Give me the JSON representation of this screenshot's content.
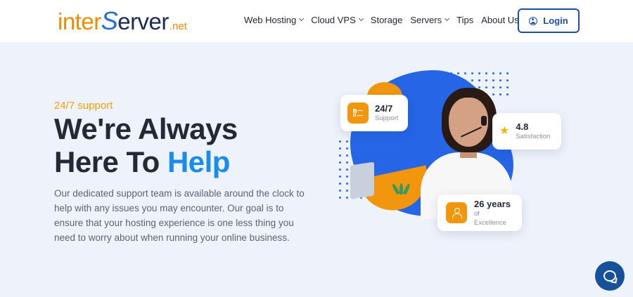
{
  "header": {
    "logo": {
      "inter": "inter",
      "server_s": "S",
      "server_rest": "erver",
      "net": ".net"
    },
    "nav": [
      {
        "label": "Web Hosting",
        "has_dropdown": true
      },
      {
        "label": "Cloud VPS",
        "has_dropdown": true
      },
      {
        "label": "Storage",
        "has_dropdown": false
      },
      {
        "label": "Servers",
        "has_dropdown": true
      },
      {
        "label": "Tips",
        "has_dropdown": false
      },
      {
        "label": "About Us",
        "has_dropdown": true
      }
    ],
    "login_label": "Login",
    "login_icon": "user-circle-icon"
  },
  "hero": {
    "eyebrow": "24/7 support",
    "title_line1": "We're Always",
    "title_line2_prefix": "Here To ",
    "title_line2_highlight": "Help",
    "description": "Our dedicated support team is available around the clock to help with any issues you may encounter. Our goal is to ensure that your hosting experience is one less thing you need to worry about when running your online business."
  },
  "stats": [
    {
      "title": "24/7",
      "subtitle": "Support",
      "icon": "checklist-icon"
    },
    {
      "title": "4.8",
      "subtitle": "Satisfaction",
      "icon": "star-icon"
    },
    {
      "title": "26 years",
      "subtitle": "of Excellence",
      "icon": "user-badge-icon"
    }
  ],
  "chat": {
    "icon": "chat-bubble-icon"
  },
  "colors": {
    "accent_blue": "#1a8cf0",
    "brand_blue": "#2565e6",
    "accent_orange": "#f2960d",
    "login_border": "#1d4ea8",
    "chat_bg": "#17519b",
    "page_bg": "#eef2fb"
  }
}
